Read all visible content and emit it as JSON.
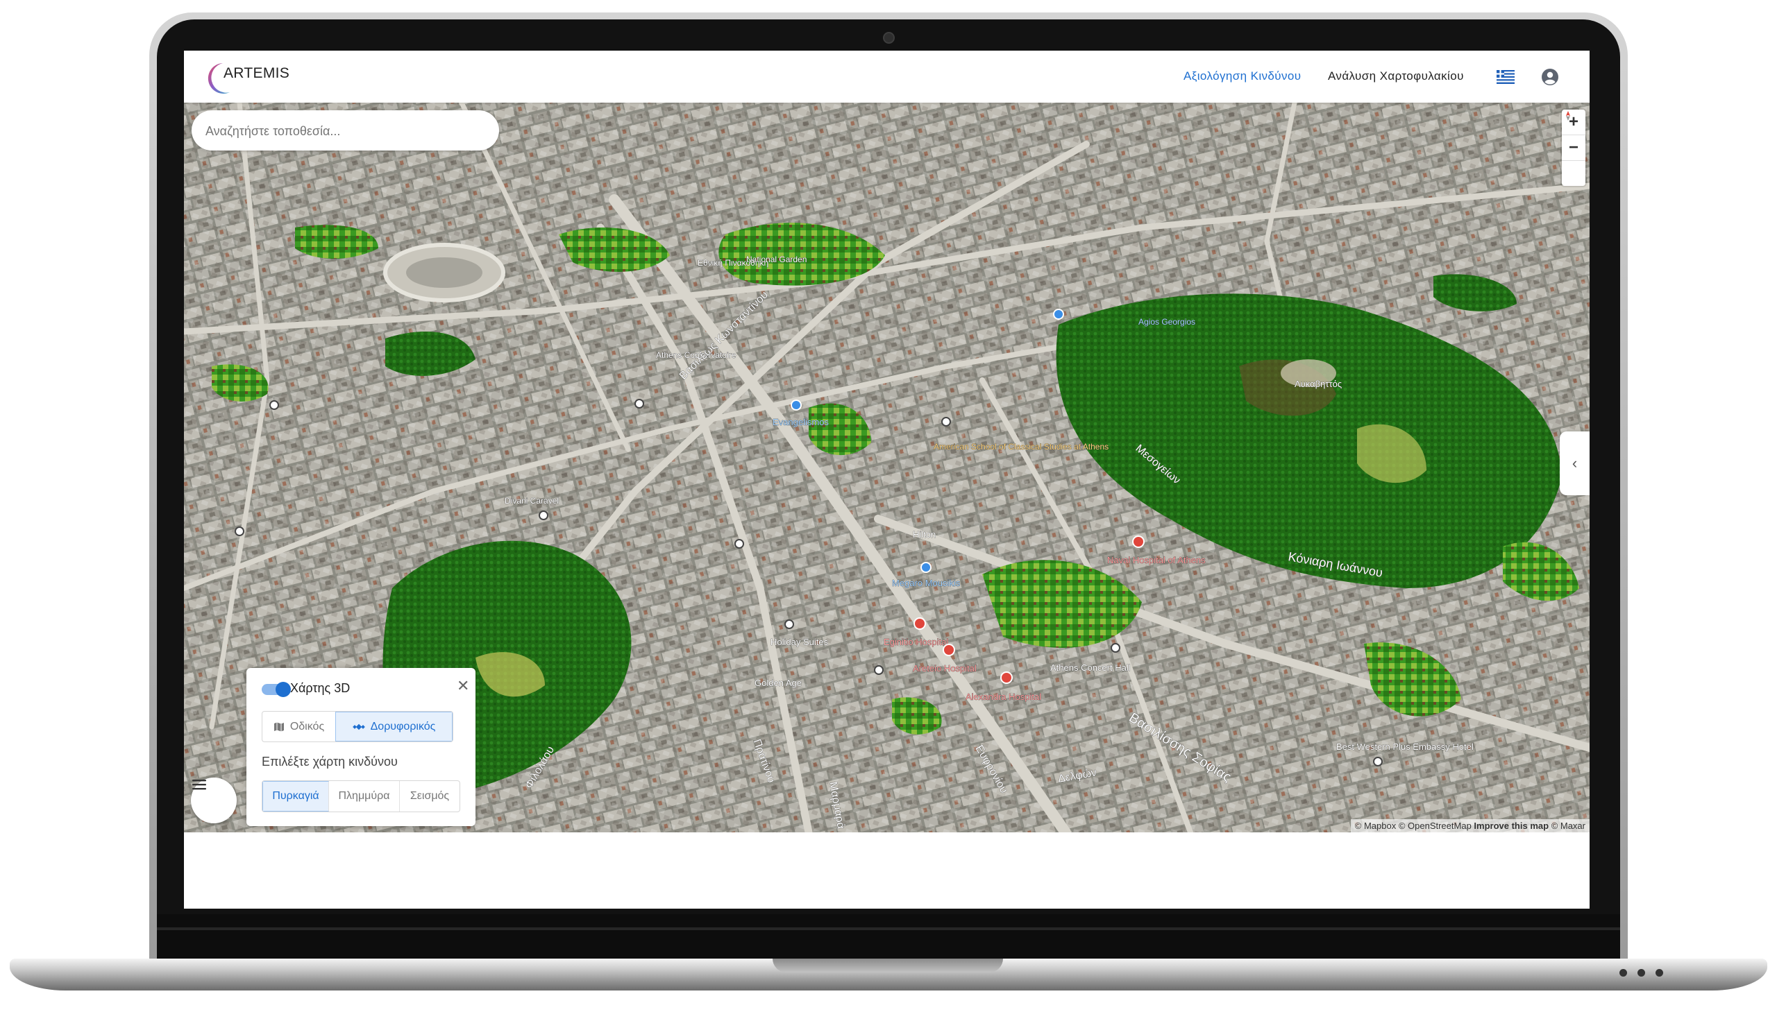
{
  "app": {
    "brand": "ARTEMIS"
  },
  "nav": {
    "risk_assessment": "Αξιολόγηση Κινδύνου",
    "portfolio_analysis": "Ανάλυση Χαρτοφυλακίου",
    "language_icon": "greek-flag-icon",
    "account_icon": "user-circle-icon"
  },
  "search": {
    "placeholder": "Αναζητήστε τοποθεσία..."
  },
  "map_controls": {
    "zoom_in": "+",
    "zoom_out": "−",
    "panel_toggle": "‹"
  },
  "attribution": {
    "mapbox": "© Mapbox",
    "osm": "© OpenStreetMap",
    "improve": "Improve this map",
    "maxar": "© Maxar"
  },
  "layer_panel": {
    "title": "Χάρτης 3D",
    "toggle_on": true,
    "basemaps": [
      "Οδικός",
      "Δορυφορικός"
    ],
    "selected_basemap": "Δορυφορικός",
    "choose_label": "Επιλέξτε χάρτη κινδύνου",
    "hazards": [
      "Πυρκαγιά",
      "Πλημμύρα",
      "Σεισμός"
    ],
    "selected_hazard": "Πυρκαγιά"
  },
  "map_labels": [
    "Λυκαβηττός",
    "Κόνιαρη Ιωάννου",
    "Βασιλίσσης Σοφίας",
    "Εθνική Πινακοθήκη",
    "National Garden",
    "Athens Conservatoire",
    "Evangelismos",
    "Megaro Mousikis",
    "Athens Concert Hall",
    "Naval Hospital of Athens",
    "Eginitio Hospital",
    "Areteio Hospital",
    "Alexandra Hospital",
    "Holiday Suites",
    "Golden Age",
    "Divani Caravel",
    "Hilton",
    "Best Western Plus Embassy Hotel",
    "Agios Georgios",
    "American School of Classical Studies at Athens",
    "Μεσογείων",
    "Πρατίνου",
    "Ευφρονίου",
    "Βασιλέως Κωνσταντίνου",
    "Φιλολάου",
    "Μαρμαρά",
    "Δελφών"
  ],
  "colors": {
    "accent": "#1e6fd0",
    "vegetation": "#2f7d1f"
  }
}
